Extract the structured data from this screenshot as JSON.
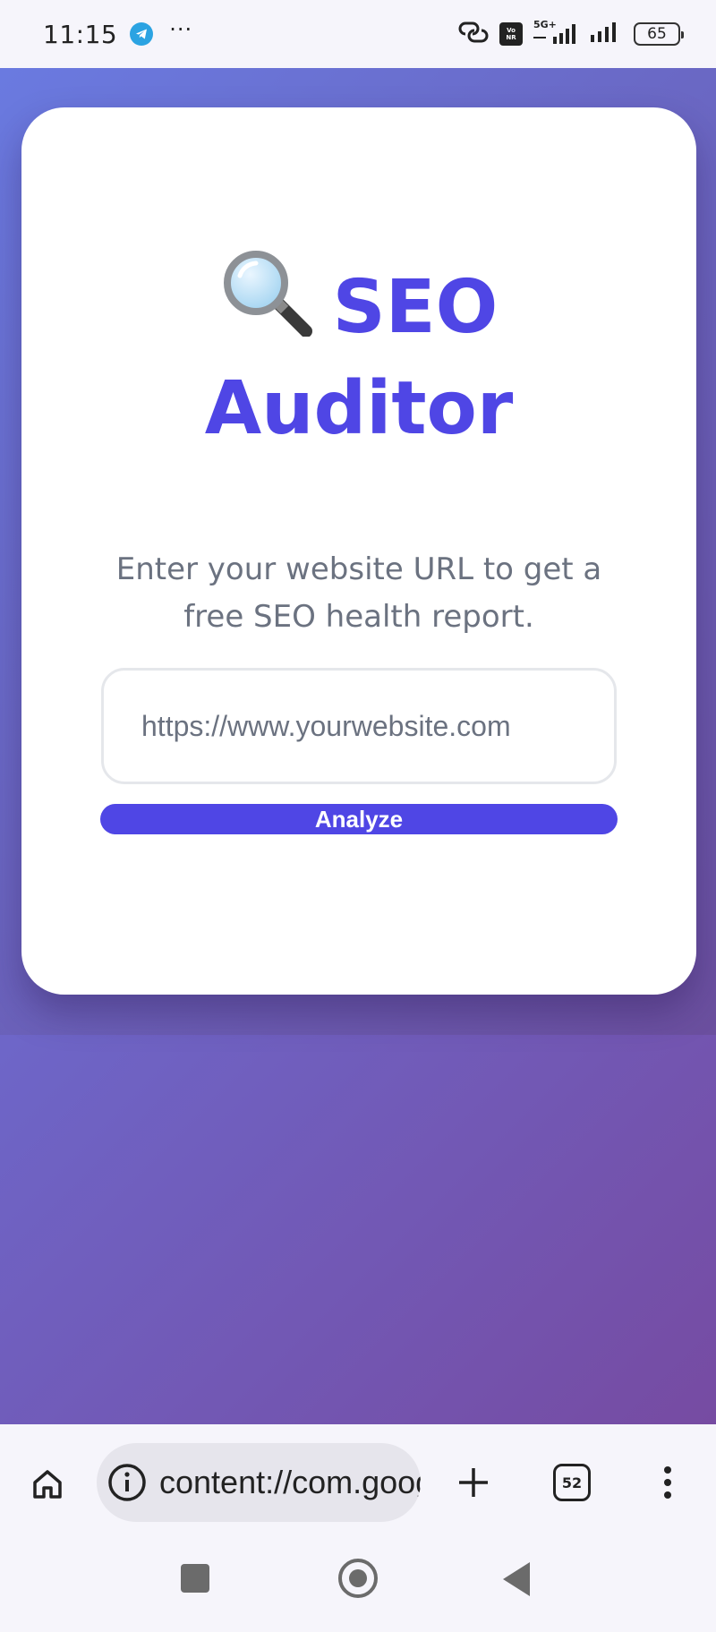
{
  "status_bar": {
    "time": "11:15",
    "dots": "···",
    "network_label": "5G+",
    "volte_label": "Vo NR",
    "battery": "65",
    "icons": [
      "telegram-icon",
      "link-icon",
      "volte-icon",
      "signal-icon",
      "signal-icon",
      "battery-icon"
    ]
  },
  "app": {
    "title_line1": "SEO",
    "title_line2": "Auditor",
    "title_icon": "magnifying-glass-icon",
    "subtitle": "Enter your website URL to get a free SEO health report.",
    "url_placeholder": "https://www.yourwebsite.com",
    "url_value": "",
    "analyze_label": "Analyze",
    "accent_color": "#4f46e5"
  },
  "browser": {
    "address": "content://com.google.android.apps.docs.storage",
    "tab_count": "52",
    "icons": [
      "home-icon",
      "info-icon",
      "plus-icon",
      "tabs-icon",
      "more-vert-icon"
    ]
  },
  "system_nav": {
    "icons": [
      "recents-icon",
      "home-circle-icon",
      "back-icon"
    ]
  }
}
